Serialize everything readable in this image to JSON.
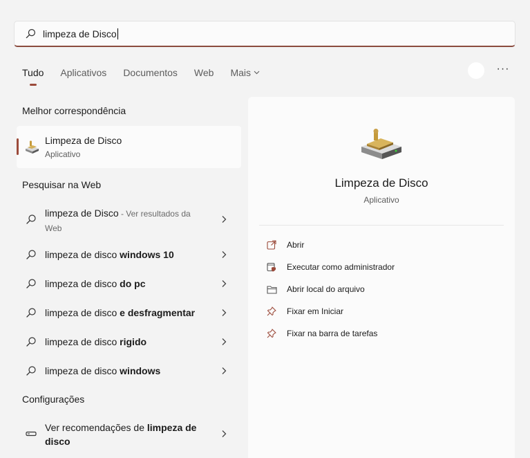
{
  "search": {
    "query": "limpeza de Disco"
  },
  "tabs": [
    {
      "label": "Tudo"
    },
    {
      "label": "Aplicativos"
    },
    {
      "label": "Documentos"
    },
    {
      "label": "Web"
    },
    {
      "label": "Mais"
    }
  ],
  "toolbar": {
    "more_label": "···"
  },
  "sections": {
    "best_match": "Melhor correspondência",
    "web": "Pesquisar na Web",
    "settings": "Configurações"
  },
  "best_match": {
    "name": "Limpeza de Disco",
    "type": "Aplicativo"
  },
  "web_results": [
    {
      "prefix": "limpeza de Disco",
      "bold": "",
      "suffix": " - Ver resultados da Web"
    },
    {
      "prefix": "limpeza de disco ",
      "bold": "windows 10",
      "suffix": ""
    },
    {
      "prefix": "limpeza de disco ",
      "bold": "do pc",
      "suffix": ""
    },
    {
      "prefix": "limpeza de disco ",
      "bold": "e desfragmentar",
      "suffix": ""
    },
    {
      "prefix": "limpeza de disco ",
      "bold": "rigido",
      "suffix": ""
    },
    {
      "prefix": "limpeza de disco ",
      "bold": "windows",
      "suffix": ""
    }
  ],
  "settings_result": {
    "prefix": "Ver recomendações de ",
    "bold": "limpeza de disco"
  },
  "detail": {
    "name": "Limpeza de Disco",
    "type": "Aplicativo",
    "actions": [
      {
        "label": "Abrir",
        "icon": "open-external-icon"
      },
      {
        "label": "Executar como administrador",
        "icon": "admin-shield-icon"
      },
      {
        "label": "Abrir local do arquivo",
        "icon": "folder-icon"
      },
      {
        "label": "Fixar em Iniciar",
        "icon": "pin-icon"
      },
      {
        "label": "Fixar na barra de tarefas",
        "icon": "pin-icon"
      }
    ]
  },
  "colors": {
    "accent": "#9b4a3a",
    "background": "#f3f3f3",
    "pane": "#fbfbfb"
  }
}
